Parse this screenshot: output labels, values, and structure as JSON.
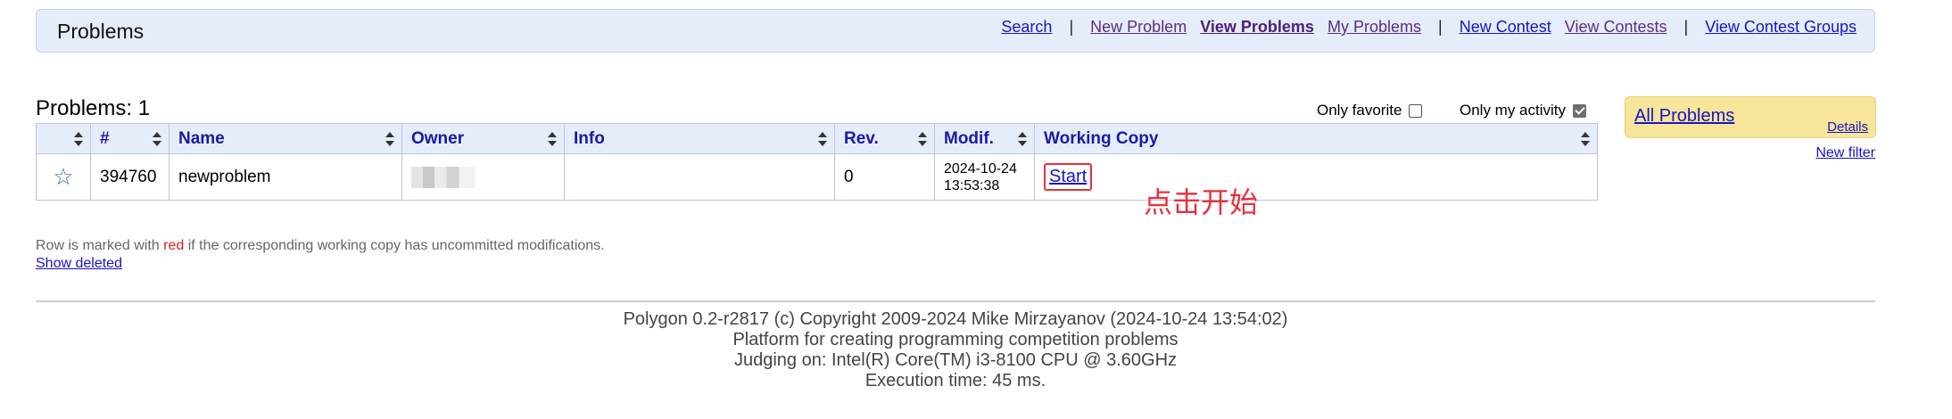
{
  "header": {
    "title": "Problems",
    "menu": {
      "search": "Search",
      "sep1": "|",
      "new_problem": "New Problem",
      "view_problems": "View Problems",
      "my_problems": "My Problems",
      "sep2": "|",
      "new_contest": "New Contest",
      "view_contests": "View Contests",
      "sep3": "|",
      "view_contest_groups": "View Contest Groups"
    }
  },
  "problems_title": "Problems: 1",
  "options": {
    "only_favorite": "Only favorite",
    "only_favorite_checked": false,
    "only_my_activity": "Only my activity",
    "only_my_activity_checked": true
  },
  "table": {
    "columns": [
      "",
      "#",
      "Name",
      "Owner",
      "Info",
      "Rev.",
      "Modif.",
      "Working Copy"
    ],
    "rows": [
      {
        "id": "394760",
        "name": "newproblem",
        "owner": "",
        "info": "",
        "rev": "0",
        "modif_date": "2024-10-24",
        "modif_time": "13:53:38",
        "working_copy": "Start"
      }
    ]
  },
  "annotation": "点击开始",
  "right_panel": {
    "all_problems": "All Problems",
    "details": "Details",
    "new_filter": "New filter"
  },
  "note": {
    "prefix": "Row is marked with ",
    "red_word": "red",
    "suffix": " if the corresponding working copy has uncommitted modifications."
  },
  "show_deleted": "Show deleted",
  "footer": {
    "line1": "Polygon 0.2-r2817 (c) Copyright 2009-2024 Mike Mirzayanov (2024-10-24 13:54:02)",
    "line2": "Platform for creating programming competition problems",
    "line3": "Judging on: Intel(R) Core(TM) i3-8100 CPU @ 3.60GHz",
    "line4": "Execution time: 45 ms."
  },
  "colors": {
    "header_bg": "#e6edfa",
    "link": "#1515c8",
    "visited": "#5a2d82",
    "annotation": "#e8303a",
    "panel_bg": "#f7e59a"
  }
}
